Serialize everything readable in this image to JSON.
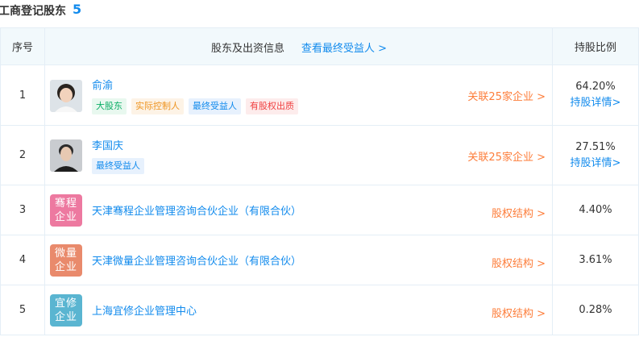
{
  "section": {
    "title": "工商登记股东",
    "count": "5"
  },
  "columns": {
    "index": "序号",
    "holder": "股东及出资信息",
    "link": "查看最终受益人 >",
    "ratio": "持股比例"
  },
  "rows": [
    {
      "index": "1",
      "name": "俞渝",
      "type": "person",
      "tags": [
        "大股东",
        "实际控制人",
        "最终受益人",
        "有股权出质"
      ],
      "related": "关联25家企业 >",
      "ratio": "64.20%",
      "detail": "持股详情>"
    },
    {
      "index": "2",
      "name": "李国庆",
      "type": "person",
      "tags": [
        "最终受益人"
      ],
      "related": "关联25家企业 >",
      "ratio": "27.51%",
      "detail": "持股详情>"
    },
    {
      "index": "3",
      "name": "天津骞程企业管理咨询合伙企业（有限合伙）",
      "type": "company",
      "logo_text": [
        "骞程",
        "企业"
      ],
      "logo_color": "#ed79a0",
      "related": "股权结构 >",
      "ratio": "4.40%"
    },
    {
      "index": "4",
      "name": "天津微量企业管理咨询合伙企业（有限合伙）",
      "type": "company",
      "logo_text": [
        "微量",
        "企业"
      ],
      "logo_color": "#e98a6c",
      "related": "股权结构 >",
      "ratio": "3.61%"
    },
    {
      "index": "5",
      "name": "上海宜修企业管理中心",
      "type": "company",
      "logo_text": [
        "宜修",
        "企业"
      ],
      "logo_color": "#5ab5d1",
      "related": "股权结构 >",
      "ratio": "0.28%"
    }
  ],
  "colors": {
    "accent": "#128bed",
    "orange": "#fd7d3a"
  }
}
